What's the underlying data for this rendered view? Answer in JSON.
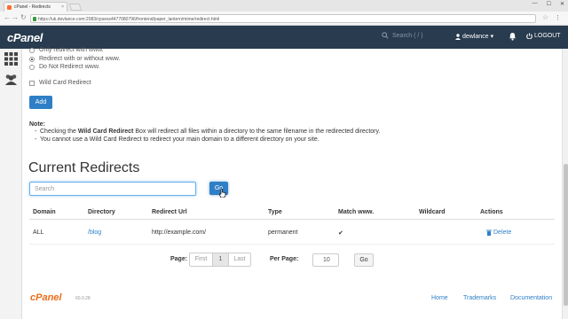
{
  "browser": {
    "tab_title": "cPanel - Redirects",
    "tab_close": "×",
    "url": "https://uk.devlance.com:2083/cpsess4477080796/frontend/paper_lantern/mime/redirect.html",
    "window_buttons": [
      "—",
      "☐",
      "✕"
    ],
    "back": "←",
    "forward": "→",
    "reload": "↻",
    "star": "☆",
    "menu": "⋮"
  },
  "header": {
    "logo": "cPanel",
    "search_placeholder": "Search ( / )",
    "user": "dewlance",
    "caret": "▾",
    "logout": "LOGOUT",
    "bg_color": "#283b4f"
  },
  "form": {
    "radio_options": [
      {
        "label": "Only redirect with www.",
        "selected": false
      },
      {
        "label": "Redirect with or without www.",
        "selected": true
      },
      {
        "label": "Do Not Redirect www.",
        "selected": false
      }
    ],
    "wildcard_label": "Wild Card Redirect",
    "add_button": "Add"
  },
  "note": {
    "heading": "Note:",
    "line1_pre": "Checking the ",
    "line1_bold": "Wild Card Redirect",
    "line1_post": " Box will redirect all files within a directory to the same filename in the redirected directory.",
    "line2": "You cannot use a Wild Card Redirect to redirect your main domain to a different directory on your site."
  },
  "redirects": {
    "title": "Current Redirects",
    "search_placeholder": "Search",
    "go_button": "Go",
    "columns": [
      "Domain",
      "Directory",
      "Redirect Url",
      "Type",
      "Match www.",
      "Wildcard",
      "Actions"
    ],
    "rows": [
      {
        "domain": "ALL",
        "directory": "/blog",
        "redirect_url": "http://example.com/",
        "type": "permanent",
        "match_www": "✔",
        "wildcard": "",
        "action": "Delete"
      }
    ]
  },
  "pagination": {
    "page_label": "Page:",
    "first": "First",
    "current": "1",
    "last": "Last",
    "per_page_label": "Per Page:",
    "per_page_value": "10",
    "go_button": "Go"
  },
  "footer": {
    "logo": "cPanel",
    "version": "60.0.28",
    "links": [
      "Home",
      "Trademarks",
      "Documentation"
    ]
  },
  "colors": {
    "accent": "#2f7fc6",
    "footer_logo": "#e96c1a"
  }
}
